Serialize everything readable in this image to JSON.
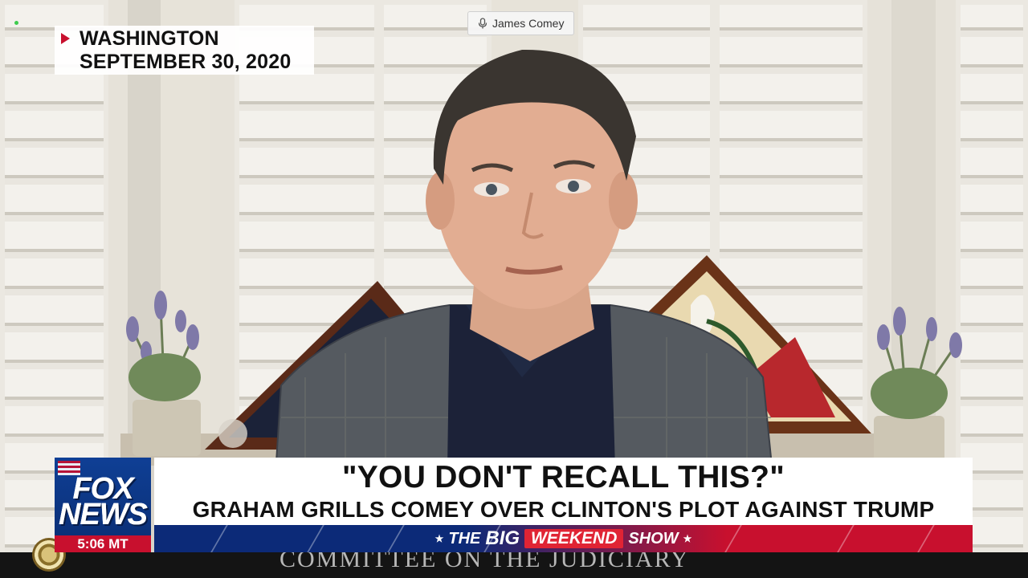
{
  "participant": {
    "name": "James Comey"
  },
  "location_bug": {
    "city": "WASHINGTON",
    "date": "SEPTEMBER 30, 2020"
  },
  "network": {
    "line1": "FOX",
    "line2": "NEWS",
    "time": "5:06 MT"
  },
  "chyron": {
    "headline": "\"YOU DON'T RECALL THIS?\"",
    "subhead": "GRAHAM GRILLS COMEY OVER CLINTON'S PLOT AGAINST TRUMP"
  },
  "show": {
    "the": "THE",
    "big": "BIG",
    "weekend": "WEEKEND",
    "show": "SHOW"
  },
  "background_feed": {
    "caption": "COMMITTEE ON THE JUDICIARY"
  },
  "colors": {
    "fox_blue": "#0c2a78",
    "fox_red": "#c8102e"
  },
  "icons": {
    "mic": "microphone-icon",
    "marker": "play-triangle-icon"
  }
}
